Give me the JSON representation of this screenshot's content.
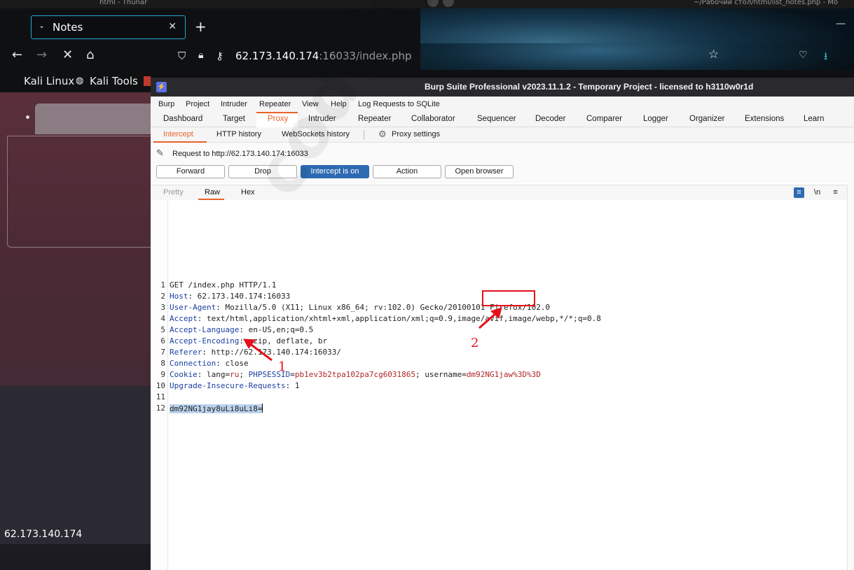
{
  "desktop": {
    "left_title": "html - Thunar",
    "right_title": "~/Рабочий стол/html/list_notes.php - Mo"
  },
  "firefox": {
    "tab_title": "Notes",
    "url_host": "62.173.140.174",
    "url_rest": ":16033/index.php",
    "bookmarks": [
      "Kali Linux",
      "Kali Tools"
    ],
    "status_url": "62.173.140.174"
  },
  "burp": {
    "title": "Burp Suite Professional v2023.11.1.2 - Temporary Project - licensed to h3110w0r1d",
    "menu": [
      "Burp",
      "Project",
      "Intruder",
      "Repeater",
      "View",
      "Help",
      "Log Requests to SQLite"
    ],
    "tabs": [
      "Dashboard",
      "Target",
      "Proxy",
      "Intruder",
      "Repeater",
      "Collaborator",
      "Sequencer",
      "Decoder",
      "Comparer",
      "Logger",
      "Organizer",
      "Extensions",
      "Learn"
    ],
    "active_tab": "Proxy",
    "subtabs": [
      "Intercept",
      "HTTP history",
      "WebSockets history",
      "Proxy settings"
    ],
    "request_label": "Request to http://62.173.140.174:16033",
    "buttons": [
      "Forward",
      "Drop",
      "Intercept is on",
      "Action",
      "Open browser"
    ],
    "editor_tabs": [
      "Pretty",
      "Raw",
      "Hex"
    ],
    "editor_icons": [
      "≡",
      "\\n",
      "≡"
    ],
    "request_lines": [
      {
        "n": "1",
        "header": "",
        "value": "GET /index.php HTTP/1.1"
      },
      {
        "n": "2",
        "header": "Host",
        "value": ": 62.173.140.174:16033"
      },
      {
        "n": "3",
        "header": "User-Agent",
        "value": ": Mozilla/5.0 (X11; Linux x86_64; rv:102.0) Gecko/20100101 Firefox/102.0"
      },
      {
        "n": "4",
        "header": "Accept",
        "value": ": text/html,application/xhtml+xml,application/xml;q=0.9,image/avif,image/webp,*/*;q=0.8"
      },
      {
        "n": "5",
        "header": "Accept-Language",
        "value": ": en-US,en;q=0.5"
      },
      {
        "n": "6",
        "header": "Accept-Encoding",
        "value": ": gzip, deflate, br"
      },
      {
        "n": "7",
        "header": "Referer",
        "value": ": http://62.173.140.174:16033/"
      },
      {
        "n": "8",
        "header": "Connection",
        "value": ": close"
      },
      {
        "n": "9",
        "header": "Cookie",
        "value": ""
      },
      {
        "n": "10",
        "header": "Upgrade-Insecure-Requests",
        "value": ": 1"
      },
      {
        "n": "11",
        "header": "",
        "value": ""
      },
      {
        "n": "12",
        "header": "",
        "value": ""
      }
    ],
    "cookie": {
      "k1": "lang",
      "v1": "ru",
      "k2": "PHPSESSID",
      "v2": "pb1ev3b2tpa102pa7cg6031865",
      "k3": "username",
      "v3": "dm92NG1jaw%3D%3D"
    },
    "body_selected": "dm92NG1jay8uLi8uLi8="
  },
  "annotations": {
    "label_1": "1",
    "label_2": "2",
    "color": "#e6101a"
  },
  "watermark": "codeby.net"
}
